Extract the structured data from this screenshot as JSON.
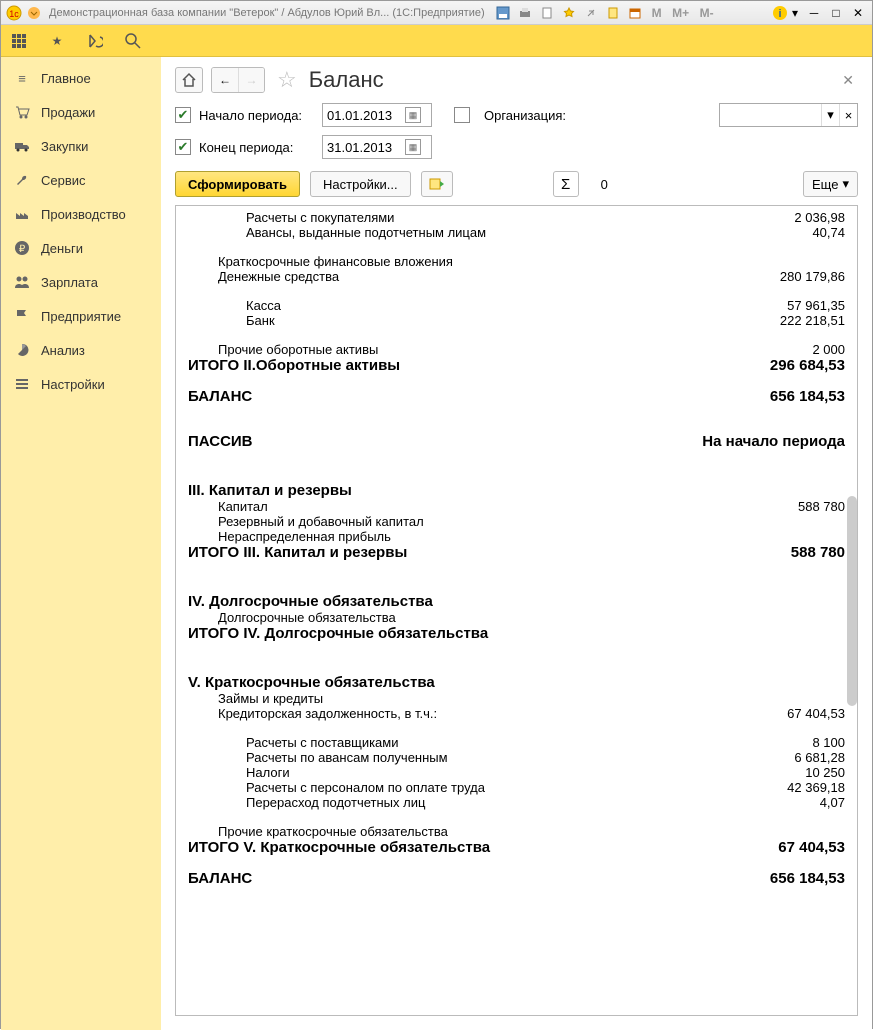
{
  "titlebar": {
    "title": "Демонстрационная база компании \"Ветерок\" / Абдулов Юрий Вл...  (1С:Предприятие)",
    "m_labels": [
      "M",
      "M+",
      "M-"
    ]
  },
  "sidebar": {
    "items": [
      {
        "label": "Главное"
      },
      {
        "label": "Продажи"
      },
      {
        "label": "Закупки"
      },
      {
        "label": "Сервис"
      },
      {
        "label": "Производство"
      },
      {
        "label": "Деньги"
      },
      {
        "label": "Зарплата"
      },
      {
        "label": "Предприятие"
      },
      {
        "label": "Анализ"
      },
      {
        "label": "Настройки"
      }
    ]
  },
  "page": {
    "title": "Баланс",
    "start_label": "Начало периода:",
    "end_label": "Конец периода:",
    "start_date": "01.01.2013",
    "end_date": "31.01.2013",
    "org_label": "Организация:",
    "btn_form": "Сформировать",
    "btn_settings": "Настройки...",
    "btn_more": "Еще",
    "sum_value": "0"
  },
  "report": {
    "r1": {
      "label": "Расчеты с покупателями",
      "val": "2 036,98"
    },
    "r2": {
      "label": "Авансы, выданные подотчетным лицам",
      "val": "40,74"
    },
    "r3": {
      "label": "Краткосрочные финансовые вложения",
      "val": ""
    },
    "r4": {
      "label": "Денежные средства",
      "val": "280 179,86"
    },
    "r5": {
      "label": "Касса",
      "val": "57 961,35"
    },
    "r6": {
      "label": "Банк",
      "val": "222 218,51"
    },
    "r7": {
      "label": "Прочие оборотные активы",
      "val": "2 000"
    },
    "t2": {
      "label": "ИТОГО II.Оборотные активы",
      "val": "296 684,53"
    },
    "bal1": {
      "label": "БАЛАНС",
      "val": "656 184,53"
    },
    "passive": {
      "label": "ПАССИВ",
      "val": "На начало периода"
    },
    "s3": {
      "label": "III. Капитал и резервы"
    },
    "r8": {
      "label": "Капитал",
      "val": "588 780"
    },
    "r9": {
      "label": "Резервный и добавочный капитал",
      "val": ""
    },
    "r10": {
      "label": "Нераспределенная прибыль",
      "val": ""
    },
    "t3": {
      "label": "ИТОГО III. Капитал и резервы",
      "val": "588 780"
    },
    "s4": {
      "label": "IV. Долгосрочные обязательства"
    },
    "r11": {
      "label": "Долгосрочные обязательства",
      "val": ""
    },
    "t4": {
      "label": "ИТОГО IV. Долгосрочные обязательства",
      "val": ""
    },
    "s5": {
      "label": "V. Краткосрочные обязательства"
    },
    "r12": {
      "label": "Займы и кредиты",
      "val": ""
    },
    "r13": {
      "label": "Кредиторская задолженность, в т.ч.:",
      "val": "67 404,53"
    },
    "r14": {
      "label": "Расчеты с поставщиками",
      "val": "8 100"
    },
    "r15": {
      "label": "Расчеты по авансам полученным",
      "val": "6 681,28"
    },
    "r16": {
      "label": "Налоги",
      "val": "10 250"
    },
    "r17": {
      "label": "Расчеты с персоналом по оплате труда",
      "val": "42 369,18"
    },
    "r18": {
      "label": "Перерасход подотчетных лиц",
      "val": "4,07"
    },
    "r19": {
      "label": "Прочие краткосрочные обязательства",
      "val": ""
    },
    "t5": {
      "label": "ИТОГО V. Краткосрочные обязательства",
      "val": "67 404,53"
    },
    "bal2": {
      "label": "БАЛАНС",
      "val": "656 184,53"
    }
  }
}
